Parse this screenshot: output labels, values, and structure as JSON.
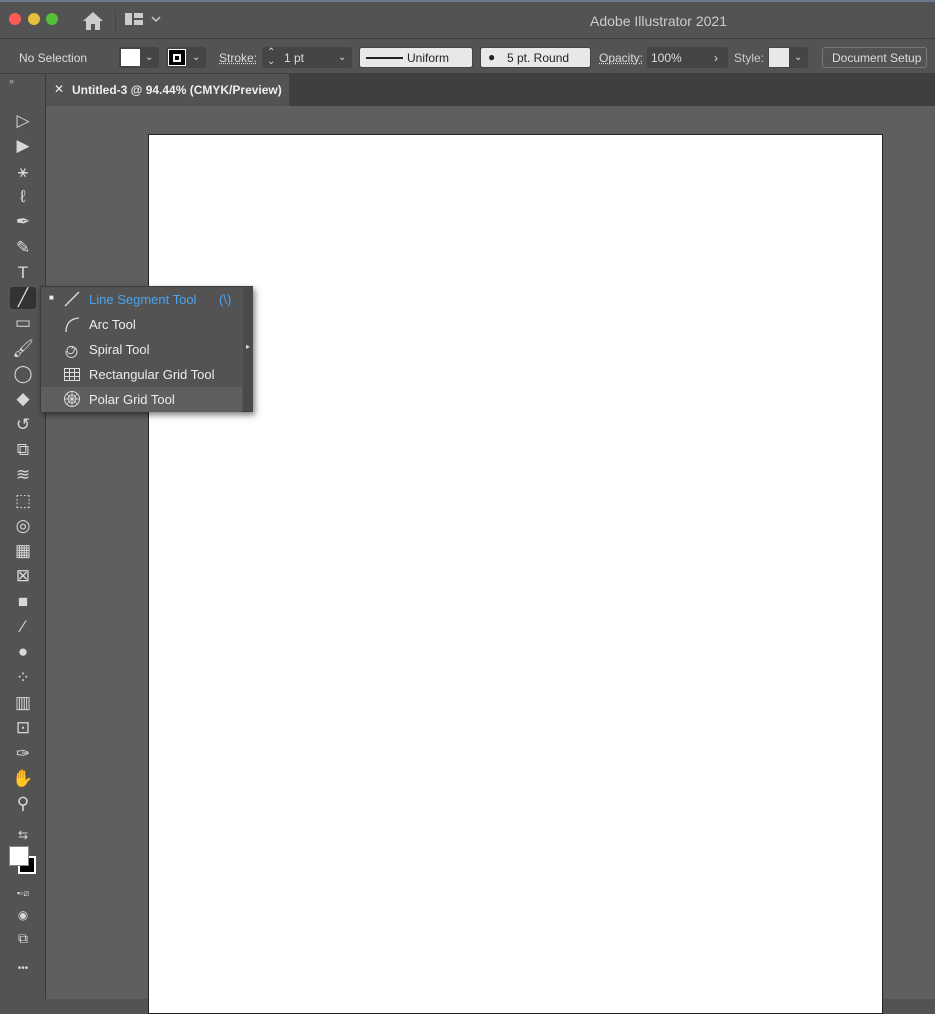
{
  "window": {
    "title": "Adobe Illustrator 2021"
  },
  "control_bar": {
    "selection": "No Selection",
    "stroke_label": "Stroke:",
    "stroke_value": "1 pt",
    "profile": "Uniform",
    "brush": "5 pt. Round",
    "opacity_label": "Opacity:",
    "opacity_value": "100%",
    "style_label": "Style:",
    "document_setup": "Document Setup"
  },
  "document_tab": {
    "title": "Untitled-3 @ 94.44% (CMYK/Preview)"
  },
  "tools": [
    {
      "name": "selection",
      "glyph": "▷"
    },
    {
      "name": "direct-selection",
      "glyph": "▶"
    },
    {
      "name": "magic-wand",
      "glyph": "⚹"
    },
    {
      "name": "lasso",
      "glyph": "ℓ"
    },
    {
      "name": "pen",
      "glyph": "✒"
    },
    {
      "name": "curvature",
      "glyph": "✎"
    },
    {
      "name": "type",
      "glyph": "T"
    },
    {
      "name": "line-segment",
      "glyph": "╱",
      "active": true
    },
    {
      "name": "rectangle",
      "glyph": "▭"
    },
    {
      "name": "paintbrush",
      "glyph": "🖌"
    },
    {
      "name": "shaper",
      "glyph": "◯"
    },
    {
      "name": "eraser",
      "glyph": "◆"
    },
    {
      "name": "rotate",
      "glyph": "↺"
    },
    {
      "name": "scale",
      "glyph": "⧉"
    },
    {
      "name": "warp",
      "glyph": "≋"
    },
    {
      "name": "free-transform",
      "glyph": "⬚"
    },
    {
      "name": "shape-builder",
      "glyph": "◎"
    },
    {
      "name": "perspective-grid",
      "glyph": "▦"
    },
    {
      "name": "mesh",
      "glyph": "⊠"
    },
    {
      "name": "gradient",
      "glyph": "■"
    },
    {
      "name": "eyedropper",
      "glyph": "⁄"
    },
    {
      "name": "blend",
      "glyph": "●"
    },
    {
      "name": "symbol-sprayer",
      "glyph": "⁘"
    },
    {
      "name": "column-graph",
      "glyph": "▥"
    },
    {
      "name": "artboard",
      "glyph": "⊡"
    },
    {
      "name": "slice",
      "glyph": "✑"
    },
    {
      "name": "hand",
      "glyph": "✋"
    },
    {
      "name": "zoom",
      "glyph": "⚲"
    }
  ],
  "flyout": {
    "items": [
      {
        "label": "Line Segment Tool",
        "shortcut": "(\\)",
        "icon": "line-icon",
        "selected": true
      },
      {
        "label": "Arc Tool",
        "icon": "arc-icon"
      },
      {
        "label": "Spiral Tool",
        "icon": "spiral-icon"
      },
      {
        "label": "Rectangular Grid Tool",
        "icon": "rect-grid-icon"
      },
      {
        "label": "Polar Grid Tool",
        "icon": "polar-grid-icon",
        "hovered": true
      }
    ]
  },
  "colors": {
    "accent": "#4aa3f0",
    "ui": "#535353",
    "canvas": "#5f5f5f"
  }
}
